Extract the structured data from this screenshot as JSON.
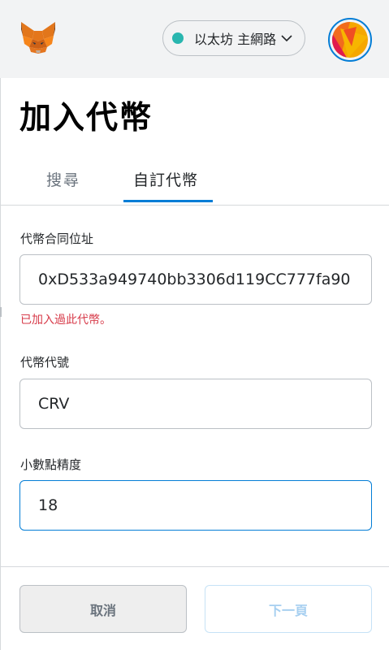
{
  "header": {
    "network_label": "以太坊 主網路",
    "network_status_color": "#29b6af",
    "logo_icon": "metamask-fox-icon",
    "account_icon": "account-avatar-icon"
  },
  "page": {
    "title": "加入代幣"
  },
  "tabs": [
    {
      "label": "搜尋",
      "active": false
    },
    {
      "label": "自訂代幣",
      "active": true
    }
  ],
  "form": {
    "address": {
      "label": "代幣合同位址",
      "value": "0xD533a949740bb3306d119CC777fa90",
      "error": "已加入過此代幣。"
    },
    "symbol": {
      "label": "代幣代號",
      "value": "CRV"
    },
    "decimals": {
      "label": "小數點精度",
      "value": "18"
    }
  },
  "footer": {
    "cancel_label": "取消",
    "next_label": "下一頁"
  },
  "colors": {
    "accent": "#037dd6",
    "error": "#d73a49",
    "header_bg": "#f2f3f4"
  }
}
